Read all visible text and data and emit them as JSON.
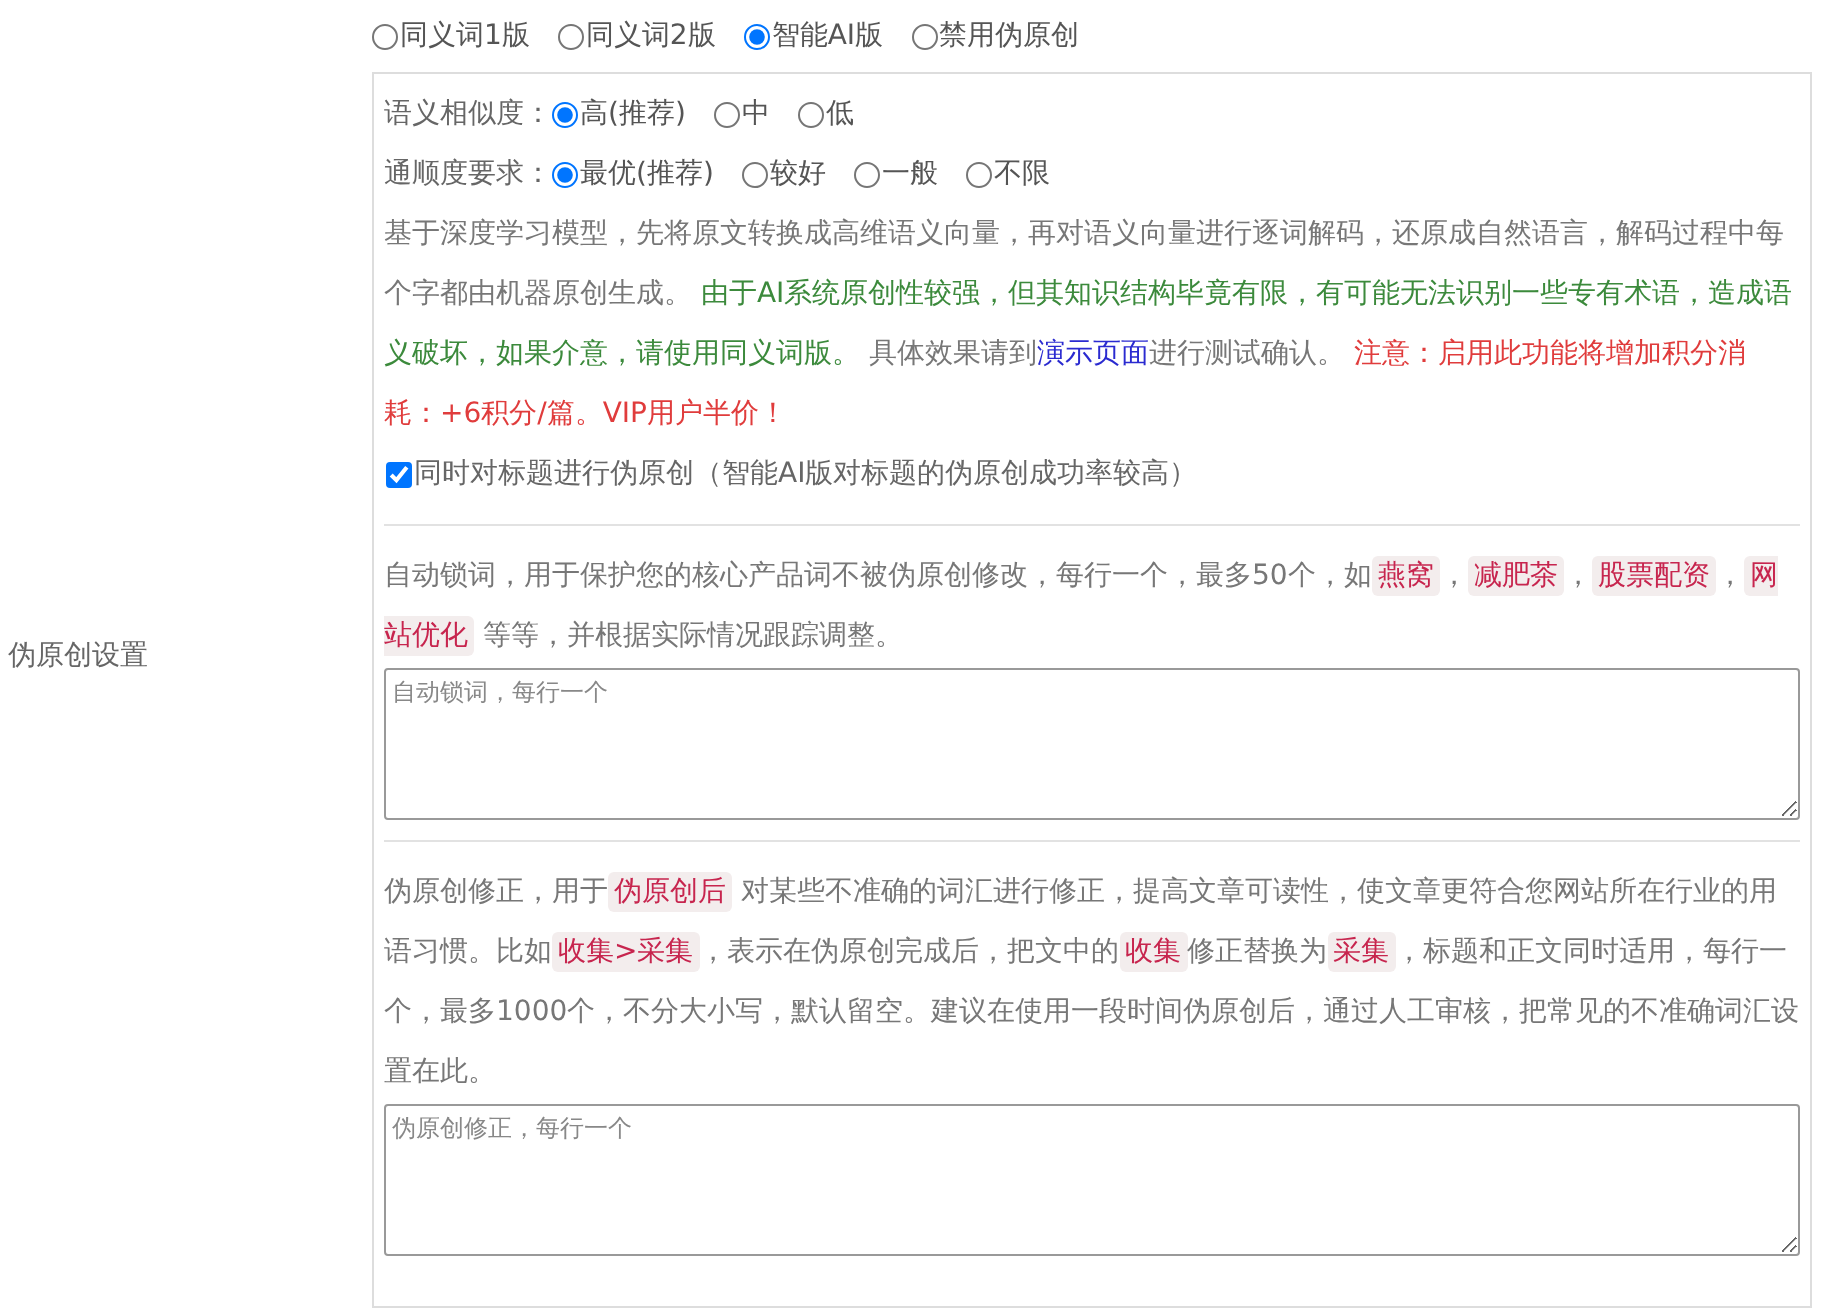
{
  "section_label": "伪原创设置",
  "versions": [
    {
      "label": "同义词1版",
      "selected": false
    },
    {
      "label": "同义词2版",
      "selected": false
    },
    {
      "label": "智能AI版",
      "selected": true
    },
    {
      "label": "禁用伪原创",
      "selected": false
    }
  ],
  "ai_options": [
    {
      "label": "语义相似度：",
      "options": [
        {
          "label": "高(推荐)",
          "selected": true
        },
        {
          "label": "中",
          "selected": false
        },
        {
          "label": "低",
          "selected": false
        }
      ]
    },
    {
      "label": "通顺度要求：",
      "options": [
        {
          "label": "最优(推荐)",
          "selected": true
        },
        {
          "label": "较好",
          "selected": false
        },
        {
          "label": "一般",
          "selected": false
        },
        {
          "label": "不限",
          "selected": false
        }
      ]
    }
  ],
  "ai_description": [
    {
      "kind": "text",
      "text": "基于深度学习模型，先将原文转换成高维语义向量，再对语义向量进行逐词解码，还原成自然语言，解码过程中每个字都由机器原创生成。 "
    },
    {
      "kind": "note",
      "text": "由于AI系统原创性较强，但其知识结构毕竟有限，有可能无法识别一些专有术语，造成语义破坏，如果介意，请使用同义词版。"
    },
    {
      "kind": "text",
      "text": " 具体效果请到"
    },
    {
      "kind": "link",
      "text": "演示页面"
    },
    {
      "kind": "text",
      "text": "进行测试确认。 "
    },
    {
      "kind": "warning",
      "text": "注意：启用此功能将增加积分消耗：+6积分/篇。VIP用户半价！"
    }
  ],
  "title_checkbox": {
    "label": "同时对标题进行伪原创（智能AI版对标题的伪原创成功率较高）",
    "checked": true
  },
  "lock_words": {
    "description": [
      {
        "kind": "text",
        "text": "自动锁词，用于保护您的核心产品词不被伪原创修改，每行一个，最多50个，如"
      },
      {
        "kind": "code",
        "text": "燕窝"
      },
      {
        "kind": "text",
        "text": "，"
      },
      {
        "kind": "code",
        "text": "减肥茶"
      },
      {
        "kind": "text",
        "text": "，"
      },
      {
        "kind": "code",
        "text": "股票配资"
      },
      {
        "kind": "text",
        "text": "，"
      },
      {
        "kind": "code",
        "text": "网站优化"
      },
      {
        "kind": "text",
        "text": " 等等，并根据实际情况跟踪调整。"
      }
    ],
    "placeholder": "自动锁词，每行一个"
  },
  "corrections": {
    "description": [
      {
        "kind": "text",
        "text": "伪原创修正，用于"
      },
      {
        "kind": "code",
        "text": "伪原创后"
      },
      {
        "kind": "text",
        "text": " 对某些不准确的词汇进行修正，提高文章可读性，使文章更符合您网站所在行业的用语习惯。比如"
      },
      {
        "kind": "code",
        "text": "收集>采集"
      },
      {
        "kind": "text",
        "text": "，表示在伪原创完成后，把文中的"
      },
      {
        "kind": "code",
        "text": "收集"
      },
      {
        "kind": "text",
        "text": "修正替换为"
      },
      {
        "kind": "code",
        "text": "采集"
      },
      {
        "kind": "text",
        "text": "，标题和正文同时适用，每行一个，最多1000个，不分大小写，默认留空。建议在使用一段时间伪原创后，通过人工审核，把常见的不准确词汇设置在此。"
      }
    ],
    "placeholder": "伪原创修正，每行一个"
  }
}
